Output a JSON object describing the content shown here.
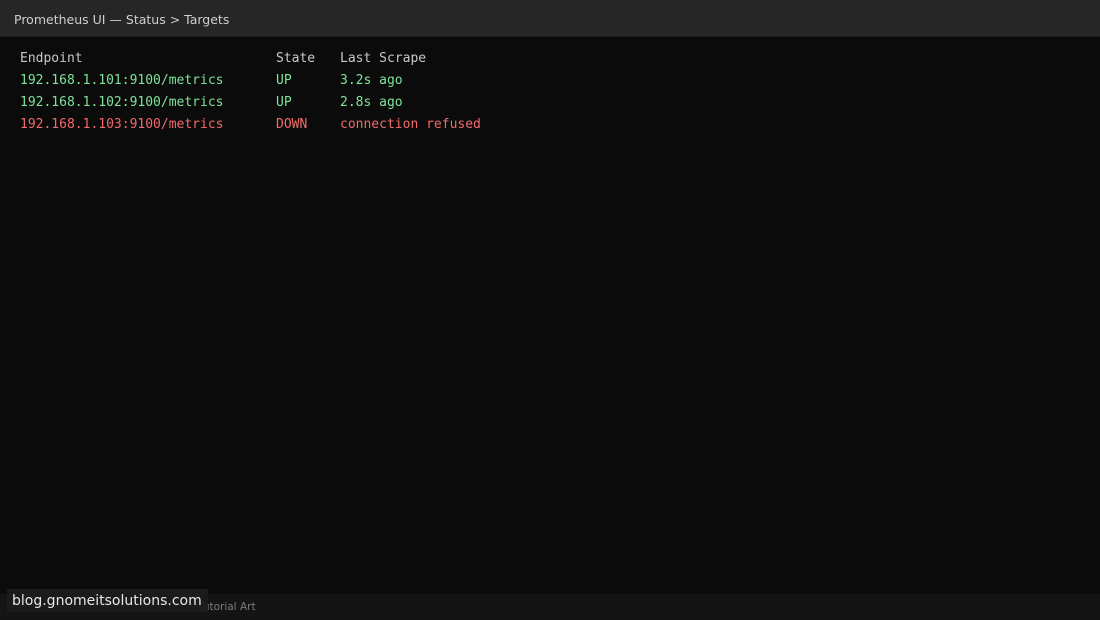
{
  "window": {
    "title": "Prometheus UI — Status > Targets"
  },
  "targets": {
    "headers": {
      "endpoint": "Endpoint",
      "state": "State",
      "last_scrape": "Last Scrape"
    },
    "rows": [
      {
        "endpoint": "192.168.1.101:9100/metrics",
        "state": "UP",
        "last_scrape": "3.2s ago"
      },
      {
        "endpoint": "192.168.1.102:9100/metrics",
        "state": "UP",
        "last_scrape": "2.8s ago"
      },
      {
        "endpoint": "192.168.1.103:9100/metrics",
        "state": "DOWN",
        "last_scrape": "connection refused"
      }
    ]
  },
  "footer": {
    "credit": "Tutorial Art"
  },
  "watermark": {
    "text": "blog.gnomeitsolutions.com"
  },
  "colors": {
    "up": "#7fe39a",
    "down": "#f26a6a",
    "background": "#0b0b0b",
    "titlebar": "#262626"
  }
}
